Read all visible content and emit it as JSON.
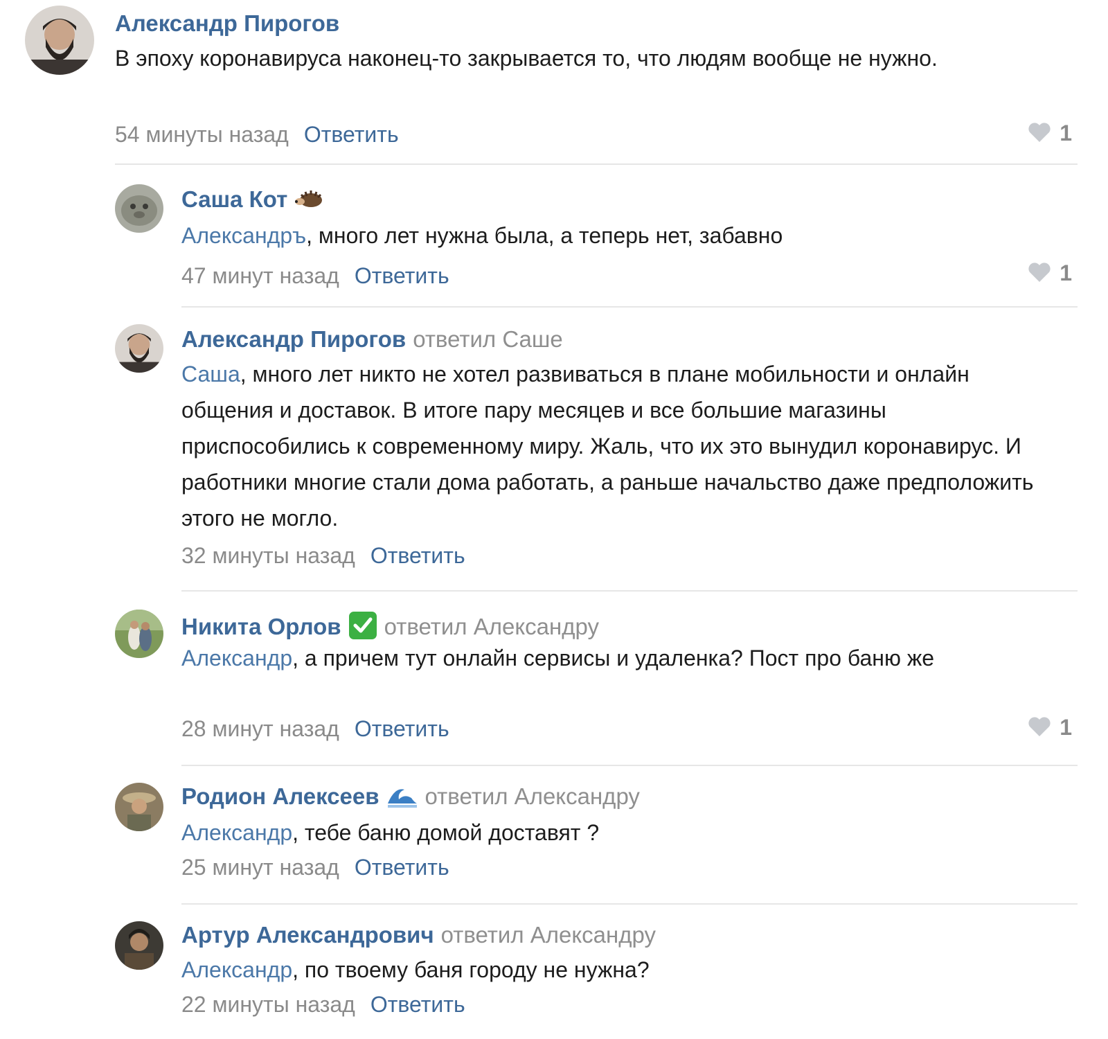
{
  "comments": [
    {
      "author": "Александр Пирогов",
      "replied_to": "",
      "mention": "",
      "text": "В эпоху коронавируса наконец-то закрывается то, что людям вообще не нужно.",
      "time": "54 минуты назад",
      "reply_label": "Ответить",
      "likes": "1"
    },
    {
      "author": "Саша Кот",
      "author_emoji": "hedgehog-emoji",
      "replied_to": "",
      "mention": "Александръ",
      "text": ", много лет нужна была, а теперь нет, забавно",
      "time": "47 минут назад",
      "reply_label": "Ответить",
      "likes": "1"
    },
    {
      "author": "Александр Пирогов",
      "replied_to": "ответил Саше",
      "mention": "Саша",
      "text": ", много лет никто не хотел развиваться в плане мобильности и онлайн общения и доставок. В итоге пару месяцев и все большие магазины приспособились к современному миру. Жаль, что их это вынудил коронавирус. И работники многие стали дома работать, а раньше начальство даже предположить этого не могло.",
      "time": "32 минуты назад",
      "reply_label": "Ответить",
      "likes": ""
    },
    {
      "author": "Никита Орлов",
      "author_emoji": "check-mark-emoji",
      "replied_to": "ответил Александру",
      "mention": "Александр",
      "text": ", а причем тут онлайн сервисы и удаленка? Пост про баню же",
      "time": "28 минут назад",
      "reply_label": "Ответить",
      "likes": "1"
    },
    {
      "author": "Родион Алексеев",
      "author_emoji": "wave-emoji",
      "replied_to": "ответил Александру",
      "mention": "Александр",
      "text": ", тебе баню домой доставят ?",
      "time": "25 минут назад",
      "reply_label": "Ответить",
      "likes": ""
    },
    {
      "author": "Артур Александрович",
      "replied_to": "ответил Александру",
      "mention": "Александр",
      "text": ", по твоему баня городу не нужна?",
      "time": "22 минуты назад",
      "reply_label": "Ответить",
      "likes": ""
    }
  ],
  "colors": {
    "author": "#3d6898",
    "mention": "#4b78a8",
    "meta": "#8a8a8a",
    "divider": "#e6e6e6",
    "check_green": "#3cb043"
  }
}
